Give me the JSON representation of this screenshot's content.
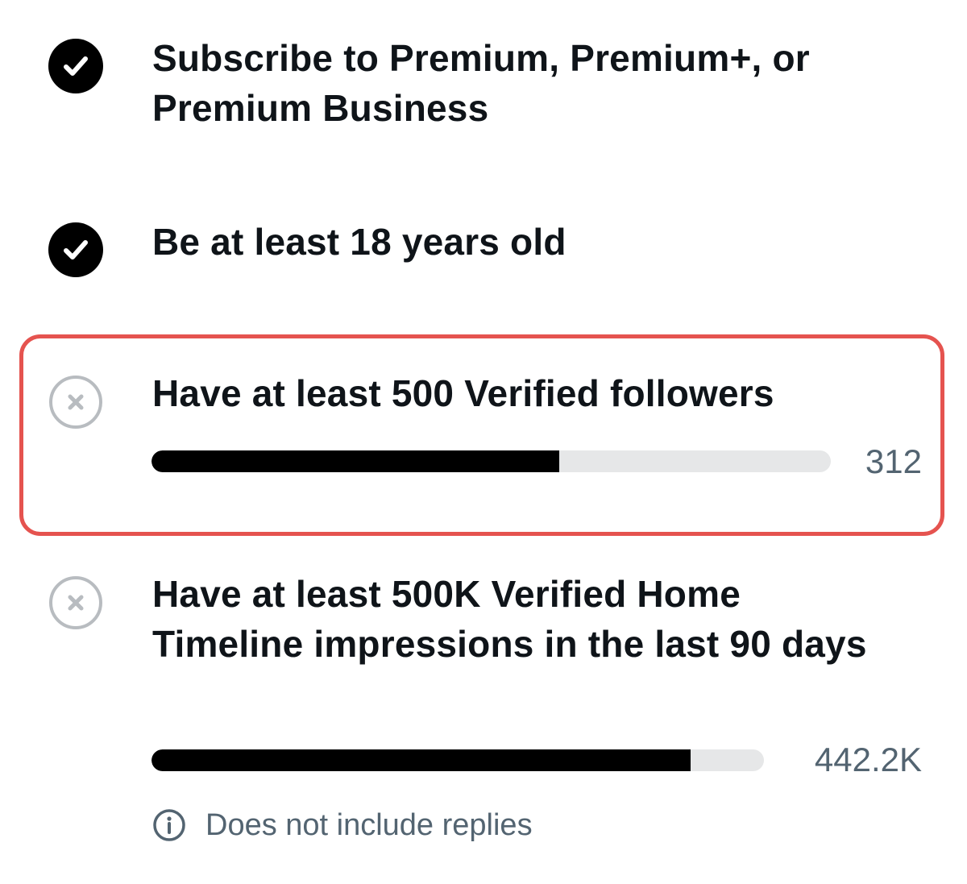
{
  "requirements": [
    {
      "status": "met",
      "status_icon": "check-circle-icon",
      "title": "Subscribe to Premium, Premium+, or Premium Business"
    },
    {
      "status": "met",
      "status_icon": "check-circle-icon",
      "title": "Be at least 18 years old"
    },
    {
      "status": "not-met",
      "status_icon": "x-circle-icon",
      "title": "Have at least 500 Verified followers",
      "progress_label": "312",
      "progress_fraction": 0.6,
      "highlighted": true
    },
    {
      "status": "not-met",
      "status_icon": "x-circle-icon",
      "title": "Have at least 500K Verified Home Timeline impressions in the last 90 days",
      "progress_label": "442.2K",
      "progress_fraction": 0.88,
      "note": {
        "icon": "info-icon",
        "text": "Does not include replies"
      }
    }
  ],
  "colors": {
    "met_icon": "#000000",
    "not_met_icon": "#b8bcc0",
    "progress_fill": "#000000",
    "progress_track": "#e6e7e8",
    "muted_text": "#536471",
    "highlight_border": "#e5534f"
  }
}
